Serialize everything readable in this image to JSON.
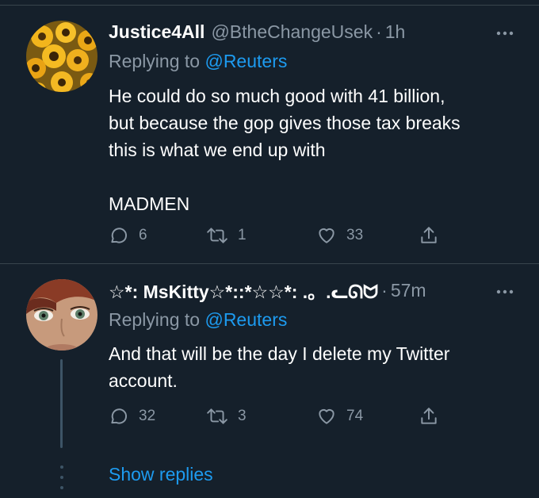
{
  "tweets": [
    {
      "name": "Justice4All",
      "handle": "@BtheChangeUsek",
      "separator": "·",
      "time": "1h",
      "more_icon": "more-dots-icon",
      "replying_prefix": "Replying to",
      "replying_to": "@Reuters",
      "body_lines": [
        "He could do so much good with 41 billion,",
        "but because the gop gives those tax breaks",
        "this is what we end up with"
      ],
      "body_extra": "MADMEN",
      "actions": {
        "replies": "6",
        "retweets": "1",
        "likes": "33"
      }
    },
    {
      "name": "☆*: MsKitty☆*::*☆☆*: .。.ᓚᘏᗢ",
      "separator": "·",
      "time": "57m",
      "more_icon": "more-dots-icon",
      "replying_prefix": "Replying to",
      "replying_to": "@Reuters",
      "body_lines": [
        "And that will be the day I delete my Twitter",
        "account."
      ],
      "actions": {
        "replies": "32",
        "retweets": "3",
        "likes": "74"
      }
    }
  ],
  "show_replies": "Show replies",
  "colors": {
    "background": "#15202b",
    "accent": "#1d9bf0",
    "muted": "#8b98a5",
    "border": "#38444d"
  }
}
